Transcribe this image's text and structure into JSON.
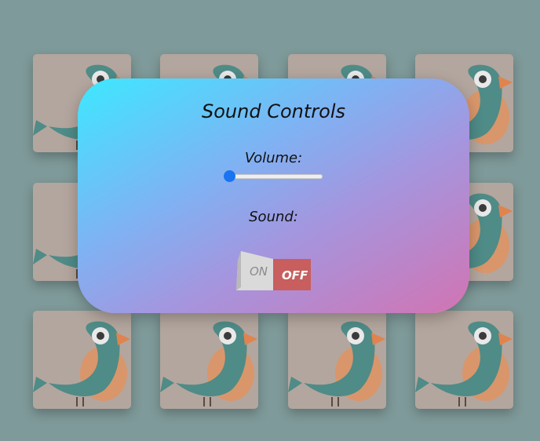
{
  "colors": {
    "background": "#7f9a9a",
    "card": "#b3a69e",
    "bird_body": "#4f8b87",
    "bird_belly": "#d9966b",
    "bird_beak": "#e0834e",
    "slider_thumb": "#1a73f0",
    "toggle_off_bg": "#c85e5e"
  },
  "board": {
    "icon": "bird-icon",
    "card_count": 12
  },
  "panel": {
    "title": "Sound Controls",
    "volume_label": "Volume:",
    "volume_value": 0,
    "sound_label": "Sound:",
    "toggle": {
      "on_label": "ON",
      "off_label": "OFF",
      "state": "off"
    }
  }
}
